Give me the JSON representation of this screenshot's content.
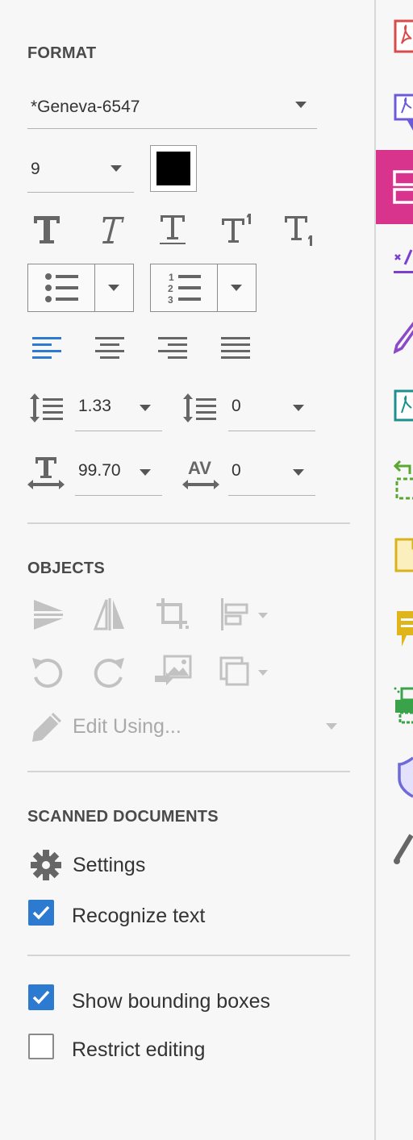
{
  "format": {
    "title": "FORMAT",
    "font_family": "*Geneva-6547",
    "font_size": "9",
    "color": "#000000",
    "line_spacing": "1.33",
    "paragraph_spacing": "0",
    "horizontal_scale": "99.70",
    "char_spacing": "0"
  },
  "objects": {
    "title": "OBJECTS",
    "edit_using_label": "Edit Using..."
  },
  "scanned": {
    "title": "SCANNED DOCUMENTS",
    "settings_label": "Settings",
    "recognize_text_label": "Recognize text",
    "recognize_text_checked": true
  },
  "options": {
    "show_bounding_boxes_label": "Show bounding boxes",
    "show_bounding_boxes_checked": true,
    "restrict_editing_label": "Restrict editing",
    "restrict_editing_checked": false
  },
  "colors": {
    "accent_blue": "#2d7ad1",
    "active_tool": "#d8348e"
  },
  "toolstrip": [
    {
      "name": "create-pdf-icon",
      "color": "#d94a4a"
    },
    {
      "name": "export-pdf-icon",
      "color": "#6b5bd9"
    },
    {
      "name": "edit-pdf-icon",
      "color": "#d8348e",
      "active": true
    },
    {
      "name": "fill-sign-icon",
      "color": "#7a3fd0"
    },
    {
      "name": "request-signature-icon",
      "color": "#8b48c9"
    },
    {
      "name": "combine-files-icon",
      "color": "#1d8f8f"
    },
    {
      "name": "organize-pages-icon",
      "color": "#5aa832"
    },
    {
      "name": "scan-ocr-icon",
      "color": "#d9b21e"
    },
    {
      "name": "comment-icon",
      "color": "#e0b51a"
    },
    {
      "name": "print-production-icon",
      "color": "#3aa34a"
    },
    {
      "name": "protect-icon",
      "color": "#6e6bd9"
    },
    {
      "name": "tools-icon",
      "color": "#666666"
    }
  ]
}
